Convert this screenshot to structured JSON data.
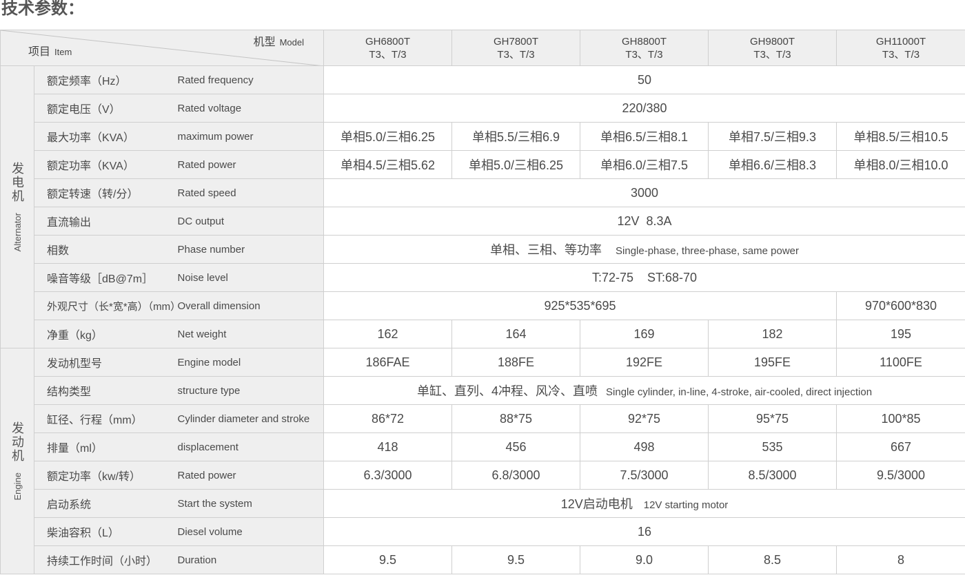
{
  "page_title": "技术参数：",
  "header": {
    "item_cn": "项目",
    "item_en": "Item",
    "model_cn": "机型",
    "model_en": "Model",
    "models": [
      {
        "name": "GH6800T",
        "variant": "T3、T/3"
      },
      {
        "name": "GH7800T",
        "variant": "T3、T/3"
      },
      {
        "name": "GH8800T",
        "variant": "T3、T/3"
      },
      {
        "name": "GH9800T",
        "variant": "T3、T/3"
      },
      {
        "name": "GH11000T",
        "variant": "T3、T/3"
      }
    ]
  },
  "groups": {
    "alternator": {
      "cn": "发电机",
      "en": "Alternator"
    },
    "engine": {
      "cn": "发动机",
      "en": "Engine"
    }
  },
  "rows": {
    "rated_frequency": {
      "cn": "额定频率（Hz）",
      "en": "Rated frequency",
      "value": "50"
    },
    "rated_voltage": {
      "cn": "额定电压（V）",
      "en": "Rated voltage",
      "value": "220/380"
    },
    "maximum_power": {
      "cn": "最大功率（KVA）",
      "en": "maximum power",
      "values": [
        "单相5.0/三相6.25",
        "单相5.5/三相6.9",
        "单相6.5/三相8.1",
        "单相7.5/三相9.3",
        "单相8.5/三相10.5"
      ]
    },
    "rated_power_alt": {
      "cn": "额定功率（KVA）",
      "en": "Rated power",
      "values": [
        "单相4.5/三相5.62",
        "单相5.0/三相6.25",
        "单相6.0/三相7.5",
        "单相6.6/三相8.3",
        "单相8.0/三相10.0"
      ]
    },
    "rated_speed": {
      "cn": "额定转速（转/分）",
      "en": "Rated speed",
      "value": "3000"
    },
    "dc_output": {
      "cn": "直流输出",
      "en": "DC output",
      "value": "12V  8.3A"
    },
    "phase_number": {
      "cn": "相数",
      "en": "Phase number",
      "value_cn": "单相、三相、等功率",
      "value_en": "Single-phase, three-phase, same power"
    },
    "noise_level": {
      "cn": "噪音等级［dB@7m］",
      "en": "Noise level",
      "value": "T:72-75    ST:68-70"
    },
    "overall_dimension": {
      "cn": "外观尺寸（长*宽*高）（mm）",
      "en": "Overall dimension",
      "value_a": "925*535*695",
      "value_b": "970*600*830"
    },
    "net_weight": {
      "cn": "净重（kg）",
      "en": "Net weight",
      "values": [
        "162",
        "164",
        "169",
        "182",
        "195"
      ]
    },
    "engine_model": {
      "cn": "发动机型号",
      "en": "Engine model",
      "values": [
        "186FAE",
        "188FE",
        "192FE",
        "195FE",
        "1100FE"
      ]
    },
    "structure_type": {
      "cn": "结构类型",
      "en": "structure type",
      "value_cn": "单缸、直列、4冲程、风冷、直喷",
      "value_en": "Single cylinder, in-line, 4-stroke, air-cooled, direct injection"
    },
    "cylinder": {
      "cn": "缸径、行程（mm）",
      "en": "Cylinder diameter and stroke",
      "values": [
        "86*72",
        "88*75",
        "92*75",
        "95*75",
        "100*85"
      ]
    },
    "displacement": {
      "cn": "排量（ml）",
      "en": "displacement",
      "values": [
        "418",
        "456",
        "498",
        "535",
        "667"
      ]
    },
    "rated_power_eng": {
      "cn": "额定功率（kw/转）",
      "en": "Rated power",
      "values": [
        "6.3/3000",
        "6.8/3000",
        "7.5/3000",
        "8.5/3000",
        "9.5/3000"
      ]
    },
    "start_system": {
      "cn": "启动系统",
      "en": "Start the system",
      "value_cn": "12V启动电机",
      "value_en": "12V starting motor"
    },
    "diesel_volume": {
      "cn": "柴油容积（L）",
      "en": "Diesel volume",
      "value": "16"
    },
    "duration": {
      "cn": "持续工作时间（小时）",
      "en": "Duration",
      "values": [
        "9.5",
        "9.5",
        "9.0",
        "8.5",
        "8"
      ]
    }
  }
}
